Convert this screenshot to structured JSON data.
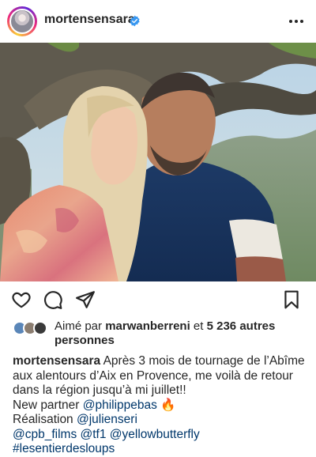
{
  "post": {
    "author": "mortensensara",
    "verified": true
  },
  "actions": {
    "like_icon": "heart-icon",
    "comment_icon": "comment-icon",
    "share_icon": "paper-plane-icon",
    "save_icon": "bookmark-icon"
  },
  "likes": {
    "prefix": "Aimé par",
    "user": "marwanberreni",
    "middle": "et",
    "count": "5 236 autres personnes"
  },
  "caption": {
    "author": "mortensensara",
    "text": "Après 3 mois de tournage de l’Abîme aux alentours d’Aix en Provence, me voilà de retour dans la région jusqu’à mi juillet!!",
    "partner_label": "New partner",
    "partner_tag": "@philippebas",
    "partner_emoji": "🔥",
    "realisation_label": "Réalisation",
    "realisation_tag": "@julienseri",
    "tag1": "@cpb_films",
    "tag2": "@tf1",
    "tag3": "@yellowbutterfly",
    "hashtag": "#lesentierdesloups"
  },
  "colors": {
    "verified_blue": "#3897f0",
    "link_blue": "#00376b"
  }
}
